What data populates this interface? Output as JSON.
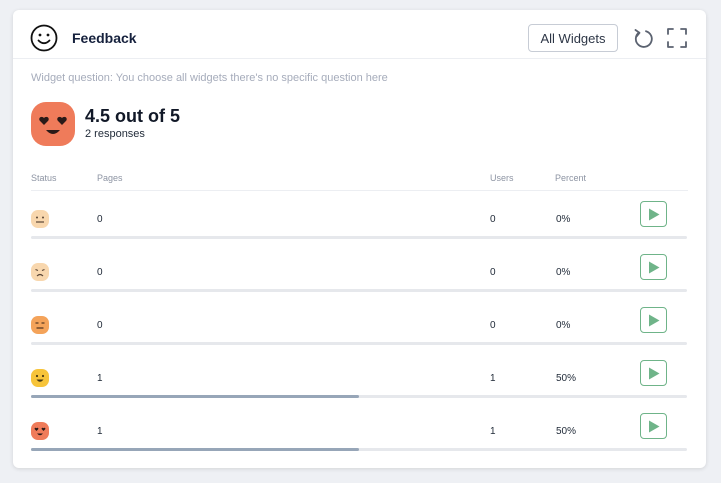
{
  "header": {
    "title": "Feedback",
    "all_widgets_label": "All Widgets",
    "icons": {
      "face": "smile-icon",
      "refresh": "refresh-icon",
      "fullscreen": "fullscreen-icon"
    }
  },
  "question": "Widget question: You choose all widgets there's no specific question here",
  "summary": {
    "score": "4.5 out of 5",
    "responses": "2 responses",
    "icon": "heart-eyes-face-icon"
  },
  "columns": {
    "status": "Status",
    "pages": "Pages",
    "users": "Users",
    "percent": "Percent"
  },
  "rows": [
    {
      "status_icon": "neutral-face-icon",
      "pages": "0",
      "users": "0",
      "percent": "0%",
      "fraction": 0
    },
    {
      "status_icon": "sad-face-icon",
      "pages": "0",
      "users": "0",
      "percent": "0%",
      "fraction": 0
    },
    {
      "status_icon": "expressionless-face-icon",
      "pages": "0",
      "users": "0",
      "percent": "0%",
      "fraction": 0
    },
    {
      "status_icon": "happy-face-icon",
      "pages": "1",
      "users": "1",
      "percent": "50%",
      "fraction": 0.5
    },
    {
      "status_icon": "heart-eyes-face-icon",
      "pages": "1",
      "users": "1",
      "percent": "50%",
      "fraction": 0.5
    }
  ],
  "colors": {
    "accent_green": "#6fb489",
    "bar_fill": "#97a6b8",
    "bar_track": "#e6e8ec"
  }
}
